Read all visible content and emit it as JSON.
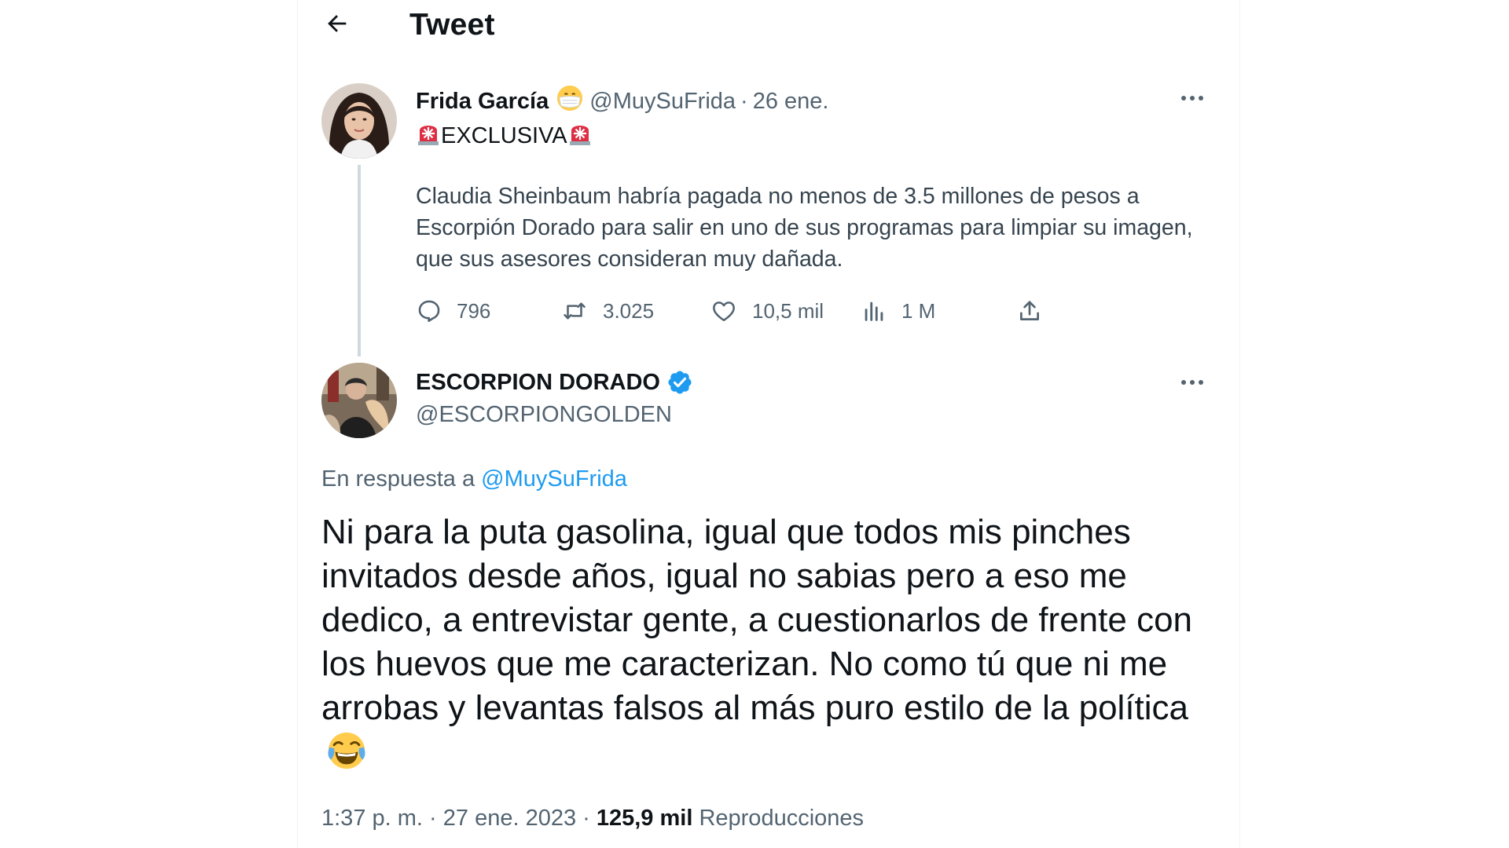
{
  "header": {
    "title": "Tweet"
  },
  "parent_tweet": {
    "name": "Frida García",
    "name_emoji": "mask-face-emoji",
    "handle": "@MuySuFrida",
    "separator": "·",
    "date": "26 ene.",
    "headline": "EXCLUSIVA",
    "headline_emoji": "siren-emoji",
    "body": "Claudia Sheinbaum habría pagada no menos de 3.5 millones de pesos a Escorpión Dorado para salir en uno de sus programas para limpiar su imagen, que sus asesores consideran muy dañada.",
    "stats": {
      "replies": "796",
      "retweets": "3.025",
      "likes": "10,5 mil",
      "views": "1 M"
    }
  },
  "reply_tweet": {
    "name": "ESCORPION DORADO",
    "handle": "@ESCORPIONGOLDEN",
    "verified": true,
    "in_reply_prefix": "En respuesta a",
    "in_reply_handle": "@MuySuFrida",
    "body": "Ni para la puta gasolina, igual que todos mis pinches invitados desde años, igual no sabias pero a eso me dedico, a entrevistar gente, a cuestionarlos de frente con los huevos que me caracterizan. No como tú que ni me arrobas y levantas falsos al más puro estilo de la política",
    "body_emoji": "face-with-tears-of-joy-emoji",
    "time": "1:37 p. m.",
    "date": "27 ene. 2023",
    "views_count": "125,9 mil",
    "views_label": "Reproducciones"
  },
  "colors": {
    "text": "#0f1419",
    "secondary": "#536471",
    "accent": "#1d9bf0",
    "thread_line": "#cfd9de"
  }
}
